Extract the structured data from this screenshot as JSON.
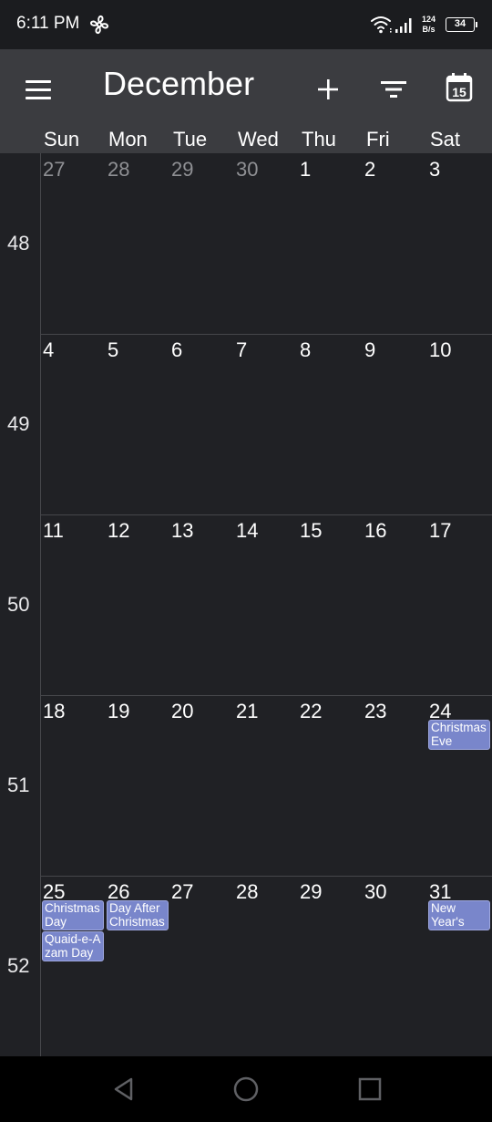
{
  "status": {
    "time": "6:11 PM",
    "net_speed_value": "124",
    "net_speed_unit": "B/s",
    "battery": "34",
    "icons": [
      "fan-icon",
      "wifi-icon",
      "signal-icon",
      "battery-icon"
    ]
  },
  "header": {
    "month": "December",
    "today_day": "15",
    "icons": [
      "menu-icon",
      "add-icon",
      "filter-icon",
      "calendar-today-icon"
    ]
  },
  "weekdays": [
    "Sun",
    "Mon",
    "Tue",
    "Wed",
    "Thu",
    "Fri",
    "Sat"
  ],
  "weeks": [
    {
      "number": "48",
      "days": [
        {
          "day": "27",
          "other_month": true
        },
        {
          "day": "28",
          "other_month": true
        },
        {
          "day": "29",
          "other_month": true
        },
        {
          "day": "30",
          "other_month": true
        },
        {
          "day": "1",
          "other_month": false
        },
        {
          "day": "2",
          "other_month": false
        },
        {
          "day": "3",
          "other_month": false
        }
      ]
    },
    {
      "number": "49",
      "days": [
        {
          "day": "4",
          "other_month": false
        },
        {
          "day": "5",
          "other_month": false
        },
        {
          "day": "6",
          "other_month": false
        },
        {
          "day": "7",
          "other_month": false
        },
        {
          "day": "8",
          "other_month": false
        },
        {
          "day": "9",
          "other_month": false
        },
        {
          "day": "10",
          "other_month": false
        }
      ]
    },
    {
      "number": "50",
      "days": [
        {
          "day": "11",
          "other_month": false
        },
        {
          "day": "12",
          "other_month": false
        },
        {
          "day": "13",
          "other_month": false
        },
        {
          "day": "14",
          "other_month": false
        },
        {
          "day": "15",
          "other_month": false
        },
        {
          "day": "16",
          "other_month": false
        },
        {
          "day": "17",
          "other_month": false
        }
      ]
    },
    {
      "number": "51",
      "days": [
        {
          "day": "18",
          "other_month": false
        },
        {
          "day": "19",
          "other_month": false
        },
        {
          "day": "20",
          "other_month": false
        },
        {
          "day": "21",
          "other_month": false
        },
        {
          "day": "22",
          "other_month": false
        },
        {
          "day": "23",
          "other_month": false
        },
        {
          "day": "24",
          "other_month": false,
          "events": [
            {
              "lines": [
                "Christmas",
                "Eve"
              ]
            }
          ]
        }
      ]
    },
    {
      "number": "52",
      "days": [
        {
          "day": "25",
          "other_month": false,
          "events": [
            {
              "lines": [
                "Christmas",
                "Day"
              ]
            },
            {
              "lines": [
                "Quaid-e-A",
                "zam Day"
              ]
            }
          ]
        },
        {
          "day": "26",
          "other_month": false,
          "events": [
            {
              "lines": [
                "Day After",
                "Christmas"
              ]
            }
          ]
        },
        {
          "day": "27",
          "other_month": false
        },
        {
          "day": "28",
          "other_month": false
        },
        {
          "day": "29",
          "other_month": false
        },
        {
          "day": "30",
          "other_month": false
        },
        {
          "day": "31",
          "other_month": false,
          "events": [
            {
              "lines": [
                "New",
                "Year's Eve"
              ]
            }
          ]
        }
      ]
    }
  ],
  "colors": {
    "background": "#202125",
    "app_bar": "#3b3c40",
    "event": "#7986cb",
    "dim_text": "#8f9094"
  },
  "nav": {
    "icons": [
      "back-icon",
      "home-icon",
      "recent-apps-icon"
    ]
  }
}
